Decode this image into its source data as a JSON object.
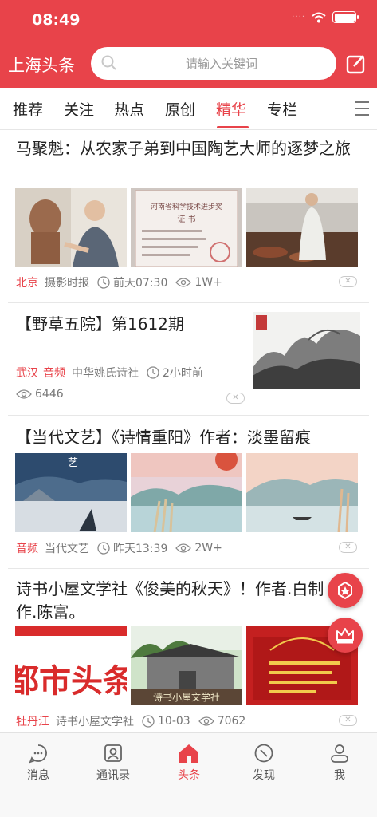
{
  "status": {
    "time": "08:49",
    "signal_dots": "····"
  },
  "header": {
    "brand": "上海头条",
    "search_placeholder": "请输入关键词"
  },
  "tabs": [
    {
      "label": "推荐"
    },
    {
      "label": "关注"
    },
    {
      "label": "热点"
    },
    {
      "label": "原创"
    },
    {
      "label": "精华",
      "active": true
    },
    {
      "label": "专栏"
    }
  ],
  "articles": [
    {
      "title": "马聚魁：从农家子弟到中国陶艺大师的逐梦之旅",
      "location": "北京",
      "source": "摄影时报",
      "time": "前天07:30",
      "views": "1W+",
      "images": [
        {
          "desc": "Man sculpting clay bust"
        },
        {
          "desc": "Certificate",
          "text_line1": "河南省科学技术进步奖",
          "text_line2": "证  书"
        },
        {
          "desc": "Pottery workshop"
        }
      ]
    },
    {
      "title": "【野草五院】第1612期",
      "location": "武汉",
      "tag": "音频",
      "source": "中华姚氏诗社",
      "time": "2小时前",
      "views": "6446",
      "images": [
        {
          "desc": "Ink landscape painting"
        }
      ]
    },
    {
      "title": "【当代文艺】《诗情重阳》作者：淡墨留痕",
      "location": "音频",
      "source": "当代文艺",
      "time": "昨天13:39",
      "views": "2W+",
      "images": [
        {
          "desc": "Misty village"
        },
        {
          "desc": "Lake with reeds"
        },
        {
          "desc": "Lake with boat"
        }
      ]
    },
    {
      "title": "诗书小屋文学社《俊美的秋天》！作者.白制作.陈富。",
      "location": "牡丹江",
      "source": "诗书小屋文学社",
      "time": "10-03",
      "views": "7062",
      "images": [
        {
          "desc": "Red calligraphy",
          "text": "都市头条"
        },
        {
          "desc": "Building with sign",
          "text": "诗书小屋文学社"
        },
        {
          "desc": "Red poem card"
        }
      ]
    }
  ],
  "bottom_nav": [
    {
      "label": "消息",
      "icon": "chat-icon"
    },
    {
      "label": "通讯录",
      "icon": "contacts-icon"
    },
    {
      "label": "头条",
      "icon": "home-icon",
      "active": true
    },
    {
      "label": "发现",
      "icon": "compass-icon"
    },
    {
      "label": "我",
      "icon": "user-icon"
    }
  ],
  "colors": {
    "accent": "#e8434a",
    "text": "#222222",
    "muted": "#777777"
  }
}
